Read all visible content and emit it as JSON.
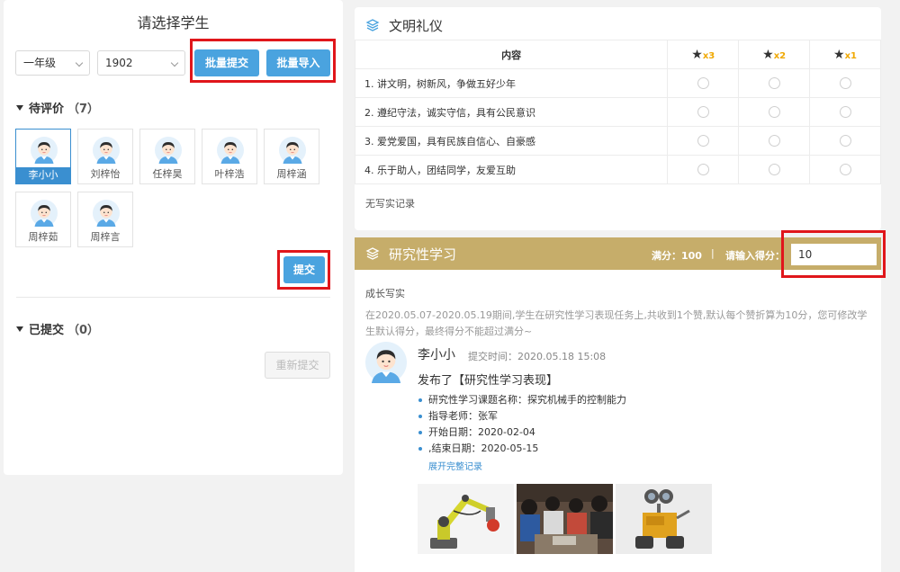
{
  "left": {
    "title": "请选择学生",
    "grade_select": "一年级",
    "class_select": "1902",
    "batch_submit_label": "批量提交",
    "batch_import_label": "批量导入",
    "pending_label": "待评价",
    "pending_count": "（7）",
    "students": [
      {
        "name": "李小小"
      },
      {
        "name": "刘梓怡"
      },
      {
        "name": "任梓昊"
      },
      {
        "name": "叶梓浩"
      },
      {
        "name": "周梓涵"
      },
      {
        "name": "周梓茹"
      },
      {
        "name": "周梓言"
      }
    ],
    "submit_label": "提交",
    "submitted_label": "已提交",
    "submitted_count": "（0）",
    "resubmit_label": "重新提交"
  },
  "etiquette": {
    "title": "文明礼仪",
    "content_header": "内容",
    "star_headers": [
      "x3",
      "x2",
      "x1"
    ],
    "rows": [
      "1. 讲文明，树新风，争做五好少年",
      "2. 遵纪守法，诚实守信，具有公民意识",
      "3. 爱党爱国，具有民族自信心、自豪感",
      "4. 乐于助人，团结同学，友爱互助"
    ],
    "no_record": "无写实记录"
  },
  "research": {
    "title": "研究性学习",
    "full_score": "满分：100",
    "separator": "|",
    "score_prompt": "请输入得分：",
    "score_value": "10",
    "growth_label": "成长写实",
    "description": "在2020.05.07-2020.05.19期间,学生在研究性学习表现任务上,共收到1个赞,默认每个赞折算为10分，您可修改学生默认得分，最终得分不能超过满分~",
    "user_name": "李小小",
    "submit_time": "提交时间：2020.05.18 15:08",
    "posted": "发布了【研究性学习表现】",
    "info": [
      "研究性学习课题名称：探究机械手的控制能力",
      "指导老师：张军",
      "开始日期：2020-02-04",
      ",结束日期：2020-05-15"
    ],
    "expand_label": "展开完整记录"
  },
  "colors": {
    "accent": "#4aa3df",
    "gold": "#c6ad6a",
    "highlight": "#e0161b",
    "star": "#f0a800"
  }
}
